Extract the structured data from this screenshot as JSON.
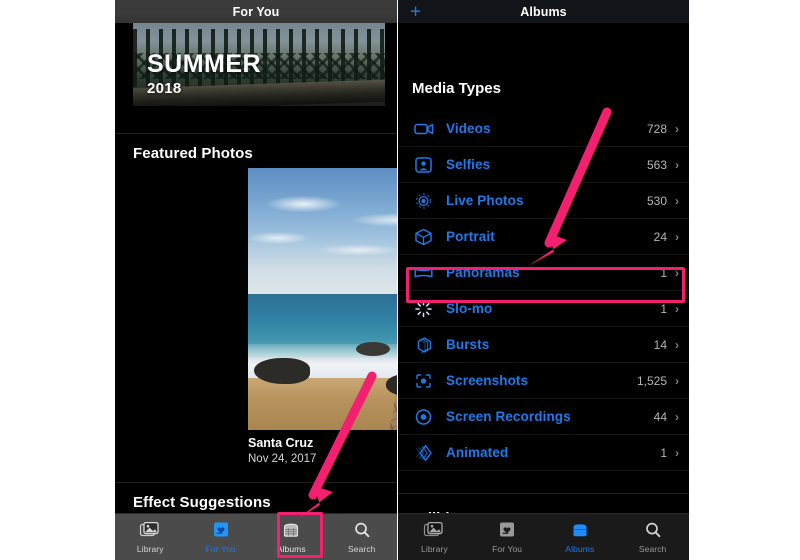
{
  "left_phone": {
    "navbar": {
      "title": "For You"
    },
    "memory": {
      "title": "SUMMER",
      "subtitle": "2018"
    },
    "sections": [
      {
        "id": "featured",
        "heading": "Featured Photos"
      },
      {
        "id": "effects",
        "heading": "Effect Suggestions"
      }
    ],
    "featured_photo": {
      "title": "Santa Cruz",
      "date": "Nov 24, 2017"
    },
    "tabbar": [
      {
        "label": "Library",
        "icon": "photo-stack-icon",
        "active": false
      },
      {
        "label": "For You",
        "icon": "heart-card-icon",
        "active": true
      },
      {
        "label": "Albums",
        "icon": "albums-box-icon",
        "active": false
      },
      {
        "label": "Search",
        "icon": "search-icon",
        "active": false
      }
    ]
  },
  "right_phone": {
    "navbar": {
      "title": "Albums",
      "add_label": "+"
    },
    "groups": [
      {
        "heading": "Media Types"
      },
      {
        "heading": "Utilities"
      }
    ],
    "media_types": [
      {
        "label": "Videos",
        "count": "728",
        "icon": "video-camera-icon",
        "chevron": "›",
        "highlighted": false
      },
      {
        "label": "Selfies",
        "count": "563",
        "icon": "selfie-person-icon",
        "chevron": "›",
        "highlighted": false
      },
      {
        "label": "Live Photos",
        "count": "530",
        "icon": "live-photo-icon",
        "chevron": "›",
        "highlighted": false
      },
      {
        "label": "Portrait",
        "count": "24",
        "icon": "portrait-cube-icon",
        "chevron": "›",
        "highlighted": false
      },
      {
        "label": "Panoramas",
        "count": "1",
        "icon": "panorama-icon",
        "chevron": "›",
        "highlighted": false
      },
      {
        "label": "Slo-mo",
        "count": "1",
        "icon": "slomo-icon",
        "chevron": "›",
        "highlighted": true
      },
      {
        "label": "Bursts",
        "count": "14",
        "icon": "bursts-icon",
        "chevron": "›",
        "highlighted": false
      },
      {
        "label": "Screenshots",
        "count": "1,525",
        "icon": "screenshot-icon",
        "chevron": "›",
        "highlighted": false
      },
      {
        "label": "Screen Recordings",
        "count": "44",
        "icon": "screen-record-icon",
        "chevron": "›",
        "highlighted": false
      },
      {
        "label": "Animated",
        "count": "1",
        "icon": "animated-icon",
        "chevron": "›",
        "highlighted": false
      }
    ],
    "tabbar": [
      {
        "label": "Library",
        "icon": "photo-stack-icon",
        "active": false
      },
      {
        "label": "For You",
        "icon": "heart-card-icon",
        "active": false
      },
      {
        "label": "Albums",
        "icon": "albums-box-icon",
        "active": true
      },
      {
        "label": "Search",
        "icon": "search-icon",
        "active": false
      }
    ]
  },
  "annotations": {
    "accent_color": "#f3206f",
    "highlight_slomo": "Slo-mo",
    "highlight_albums_tab": "Albums",
    "arrows": 2
  },
  "colors": {
    "accent_pink": "#f3206f",
    "link_blue": "#1f7ae8",
    "background_black": "#000000",
    "tabbar_left": "#4b4b4b",
    "tabbar_right": "#1a1a1a",
    "count_gray": "#b5b5b5"
  }
}
